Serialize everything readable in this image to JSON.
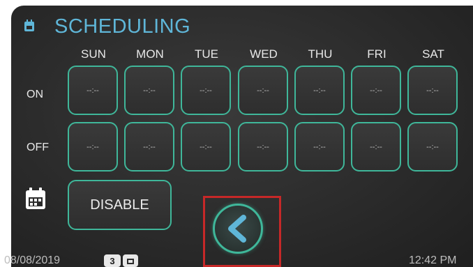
{
  "header": {
    "title": "SCHEDULING",
    "icon": "calendar-icon"
  },
  "days": [
    "SUN",
    "MON",
    "TUE",
    "WED",
    "THU",
    "FRI",
    "SAT"
  ],
  "rows": [
    {
      "label": "ON",
      "values": [
        "--:--",
        "--:--",
        "--:--",
        "--:--",
        "--:--",
        "--:--",
        "--:--"
      ]
    },
    {
      "label": "OFF",
      "values": [
        "--:--",
        "--:--",
        "--:--",
        "--:--",
        "--:--",
        "--:--",
        "--:--"
      ]
    }
  ],
  "disable_button": {
    "label": "DISABLE"
  },
  "status_bar": {
    "date": "08/08/2019",
    "badge": "3",
    "time": "12:42 PM"
  },
  "colors": {
    "accent": "#5fb6d8",
    "slot_border": "#3fb79a",
    "highlight": "#c62828"
  }
}
